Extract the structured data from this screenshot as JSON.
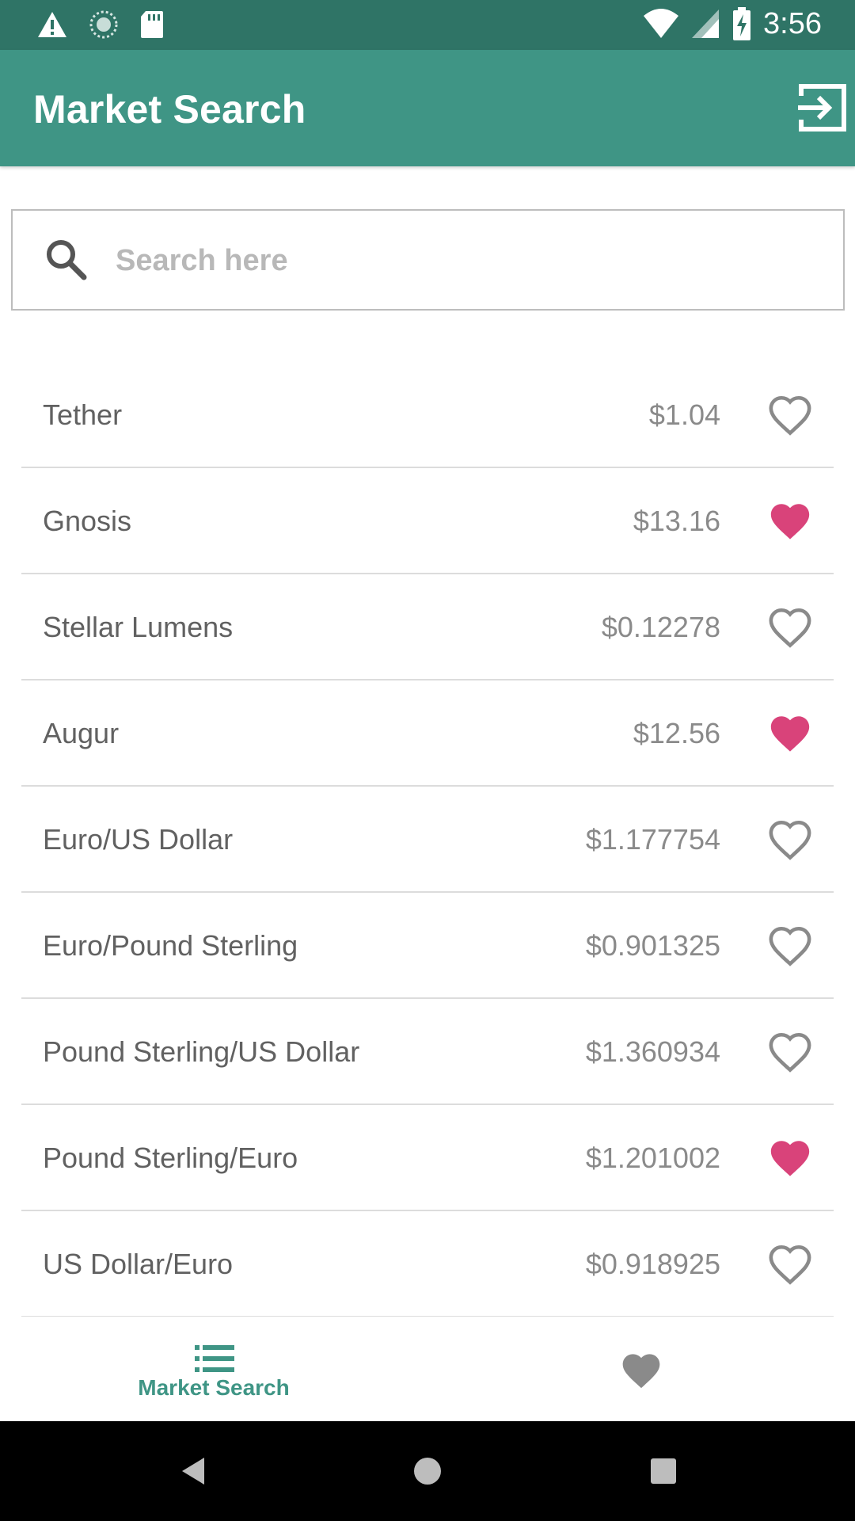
{
  "status_bar": {
    "time": "3:56",
    "icons": [
      "warning-icon",
      "sync-icon",
      "sd-card-icon",
      "wifi-icon",
      "cell-signal-icon",
      "battery-charging-icon"
    ]
  },
  "app_bar": {
    "title": "Market Search",
    "action_icon": "logout-icon"
  },
  "search": {
    "placeholder": "Search here",
    "value": ""
  },
  "markets": [
    {
      "name": "Tether",
      "price": "$1.04",
      "favorite": false
    },
    {
      "name": "Gnosis",
      "price": "$13.16",
      "favorite": true
    },
    {
      "name": "Stellar Lumens",
      "price": "$0.12278",
      "favorite": false
    },
    {
      "name": "Augur",
      "price": "$12.56",
      "favorite": true
    },
    {
      "name": "Euro/US Dollar",
      "price": "$1.177754",
      "favorite": false
    },
    {
      "name": "Euro/Pound Sterling",
      "price": "$0.901325",
      "favorite": false
    },
    {
      "name": "Pound Sterling/US Dollar",
      "price": "$1.360934",
      "favorite": false
    },
    {
      "name": "Pound Sterling/Euro",
      "price": "$1.201002",
      "favorite": true
    },
    {
      "name": "US Dollar/Euro",
      "price": "$0.918925",
      "favorite": false
    }
  ],
  "bottom_nav": {
    "market_label": "Market Search",
    "market_icon": "list-icon",
    "favorites_icon": "heart-icon"
  },
  "colors": {
    "status_bar": "#2f7466",
    "app_bar": "#3f9585",
    "accent": "#3f9585",
    "favorite": "#d9437a",
    "heart_outline": "#8a8a8a",
    "nav_inactive": "#8a8a8a"
  }
}
